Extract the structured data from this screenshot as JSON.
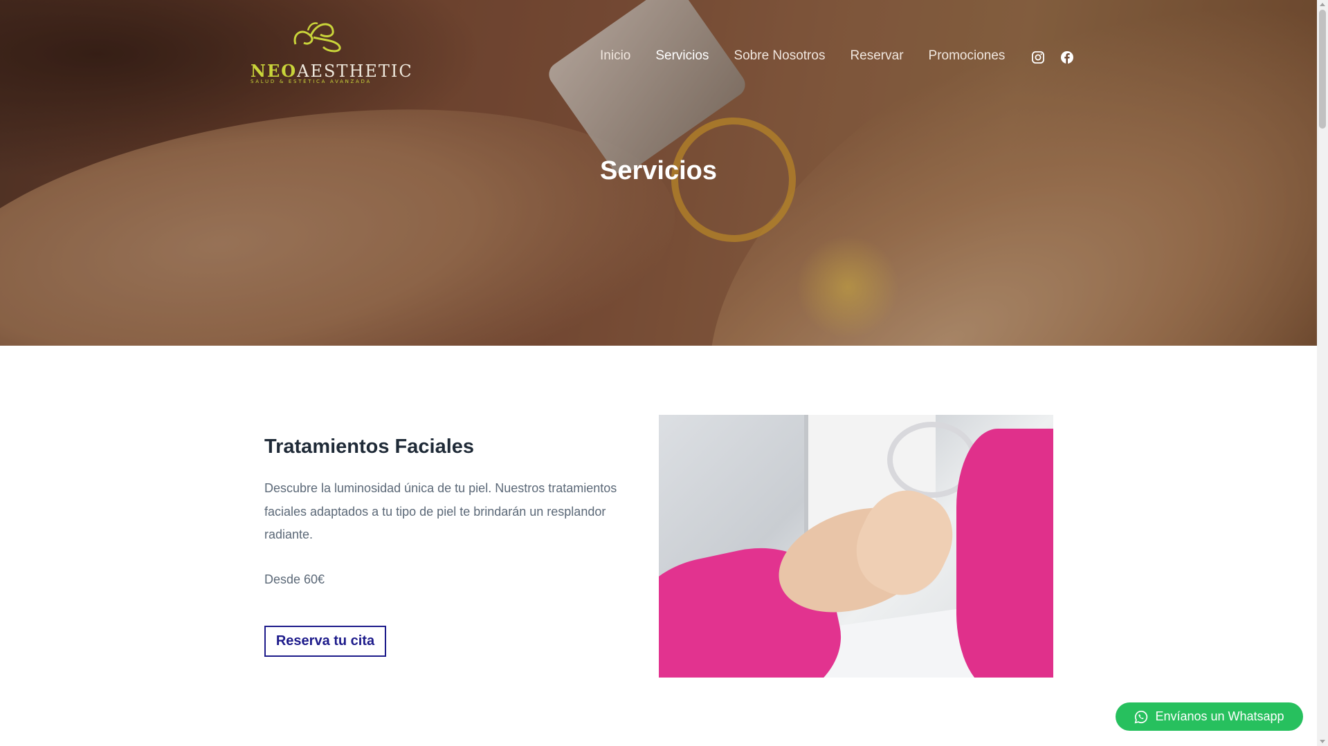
{
  "brand": {
    "logo_word_neo": "NEO",
    "logo_word_rest": "AESTHETIC",
    "logo_tagline": "SALUD & ESTÉTICA AVANZADA",
    "accent_color": "#c9d43a"
  },
  "nav": {
    "items": [
      {
        "label": "Inicio"
      },
      {
        "label": "Servicios"
      },
      {
        "label": "Sobre Nosotros"
      },
      {
        "label": "Reservar"
      },
      {
        "label": "Promociones"
      }
    ],
    "active": "Servicios",
    "social_icons": [
      "instagram-icon",
      "facebook-icon"
    ]
  },
  "hero": {
    "title": "Servicios"
  },
  "service": {
    "title": "Tratamientos Faciales",
    "description": "Descubre la luminosidad única de tu piel. Nuestros tratamientos faciales adaptados a tu tipo de piel te brindarán un resplandor radiante.",
    "price": "Desde 60€",
    "cta_label": "Reserva tu cita",
    "cta_color": "#1c1a8a"
  },
  "whatsapp": {
    "label": "Envíanos un Whatsapp",
    "color": "#27c05e"
  }
}
